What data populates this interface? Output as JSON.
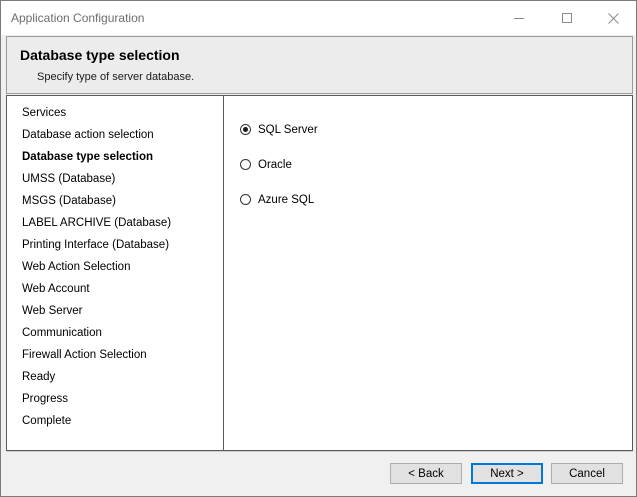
{
  "window": {
    "title": "Application Configuration"
  },
  "header": {
    "title": "Database type selection",
    "subtitle": "Specify type of server database."
  },
  "sidebar": {
    "items": [
      {
        "label": "Services",
        "active": false
      },
      {
        "label": "Database action selection",
        "active": false
      },
      {
        "label": "Database type selection",
        "active": true
      },
      {
        "label": "UMSS (Database)",
        "active": false
      },
      {
        "label": "MSGS (Database)",
        "active": false
      },
      {
        "label": "LABEL ARCHIVE (Database)",
        "active": false
      },
      {
        "label": "Printing Interface (Database)",
        "active": false
      },
      {
        "label": "Web Action Selection",
        "active": false
      },
      {
        "label": "Web Account",
        "active": false
      },
      {
        "label": "Web Server",
        "active": false
      },
      {
        "label": "Communication",
        "active": false
      },
      {
        "label": "Firewall Action Selection",
        "active": false
      },
      {
        "label": "Ready",
        "active": false
      },
      {
        "label": "Progress",
        "active": false
      },
      {
        "label": "Complete",
        "active": false
      }
    ]
  },
  "options": {
    "selected": "SQL Server",
    "items": [
      {
        "label": "SQL Server"
      },
      {
        "label": "Oracle"
      },
      {
        "label": "Azure SQL"
      }
    ]
  },
  "footer": {
    "back_label": "< Back",
    "next_label": "Next >",
    "cancel_label": "Cancel"
  },
  "icons": {
    "minimize": "minimize-icon",
    "maximize": "maximize-icon",
    "close": "close-icon"
  },
  "colors": {
    "default_button_border": "#0078d7",
    "window_background": "#f0f0f0"
  }
}
